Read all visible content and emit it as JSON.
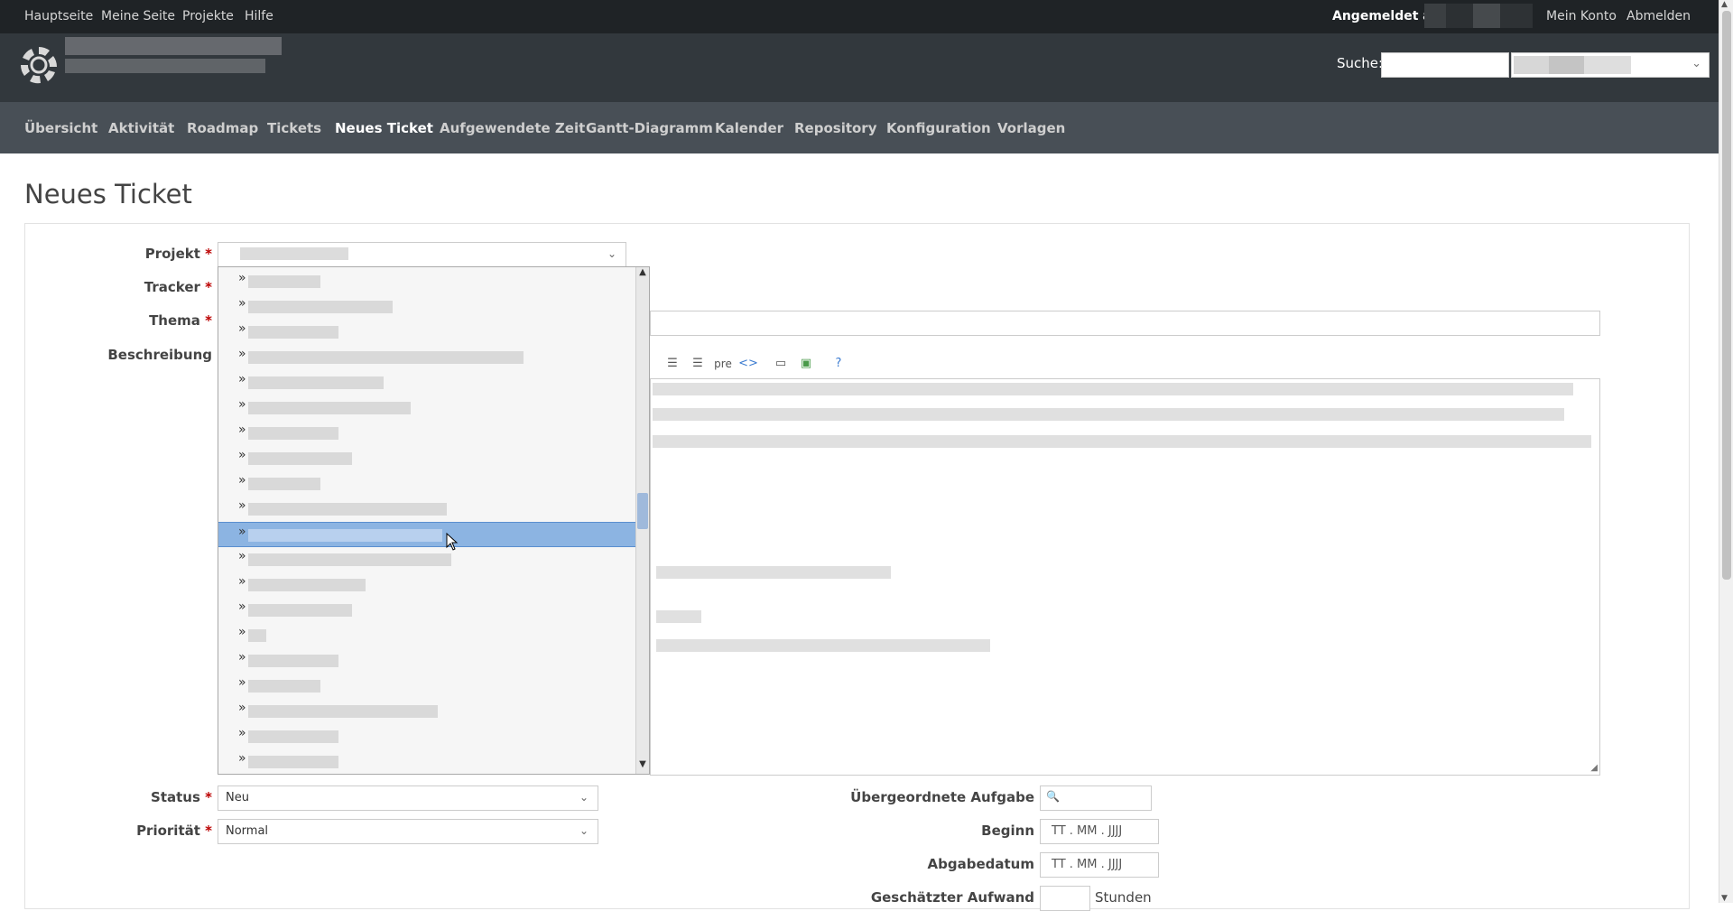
{
  "top_menu": {
    "left_links": [
      "Hauptseite",
      "Meine Seite",
      "Projekte",
      "Hilfe"
    ],
    "logged_in_as": "Angemeldet als",
    "my_account": "Mein Konto",
    "logout": "Abmelden"
  },
  "header": {
    "search_label": "Suche:",
    "search_value": ""
  },
  "main_menu": {
    "tabs": [
      "Übersicht",
      "Aktivität",
      "Roadmap",
      "Tickets",
      "Neues Ticket",
      "Aufgewendete Zeit",
      "Gantt-Diagramm",
      "Kalender",
      "Repository",
      "Konfiguration",
      "Vorlagen"
    ],
    "selected": "Neues Ticket"
  },
  "page": {
    "title": "Neues Ticket"
  },
  "form": {
    "required_mark": "*",
    "projekt_label": "Projekt",
    "tracker_label": "Tracker",
    "thema_label": "Thema",
    "beschreibung_label": "Beschreibung",
    "status_label": "Status",
    "status_value": "Neu",
    "prioritaet_label": "Priorität",
    "prioritaet_value": "Normal",
    "parent_task_label": "Übergeordnete Aufgabe",
    "beginn_label": "Beginn",
    "beginn_placeholder": "TT . MM . JJJJ",
    "abgabedatum_label": "Abgabedatum",
    "abgabedatum_placeholder": "TT . MM . JJJJ",
    "aufwand_label": "Geschätzter Aufwand",
    "aufwand_unit": "Stunden"
  },
  "editor_toolbar": {
    "pre_label": "pre",
    "code_label": "<>",
    "help_label": "?"
  },
  "dropdown": {
    "item_marker": "»",
    "item_count": 20,
    "highlighted_index": 10
  },
  "colors": {
    "top_bar": "#1f2326",
    "header": "#32383d",
    "main_menu": "#484f56",
    "required": "#bb0000",
    "highlight": "#8cb4e2"
  }
}
